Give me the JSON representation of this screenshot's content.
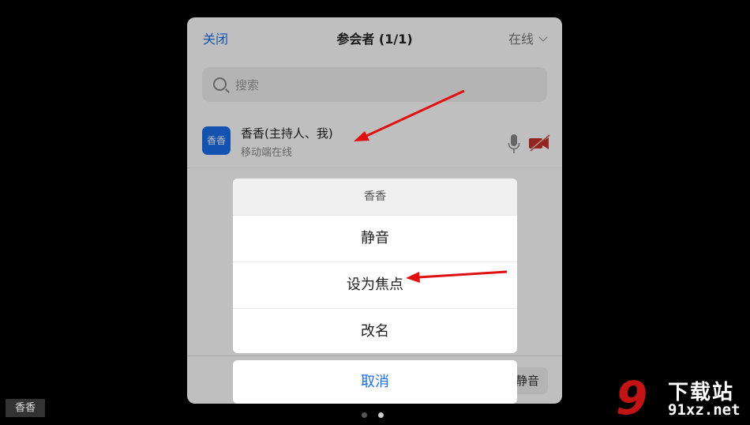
{
  "header": {
    "close_label": "关闭",
    "title": "参会者 (1/1)",
    "filter_label": "在线"
  },
  "search": {
    "placeholder": "搜索"
  },
  "participant": {
    "avatar_text": "香香",
    "name": "香香(主持人、我)",
    "status": "移动端在线"
  },
  "bottom": {
    "mute_all_label": "静音"
  },
  "action_sheet": {
    "title": "香香",
    "items": [
      "静音",
      "设为焦点",
      "改名"
    ],
    "cancel_label": "取消"
  },
  "video_tile": {
    "name_tag": "香香"
  },
  "page_indicator": {
    "count": 2,
    "current": 2
  },
  "watermark": {
    "number": "9",
    "text_top": "下载站",
    "text_bottom": "91xz.net"
  },
  "colors": {
    "accent": "#1a6ee8",
    "annotation": "#e01010",
    "muted_camera": "#c4302b"
  }
}
